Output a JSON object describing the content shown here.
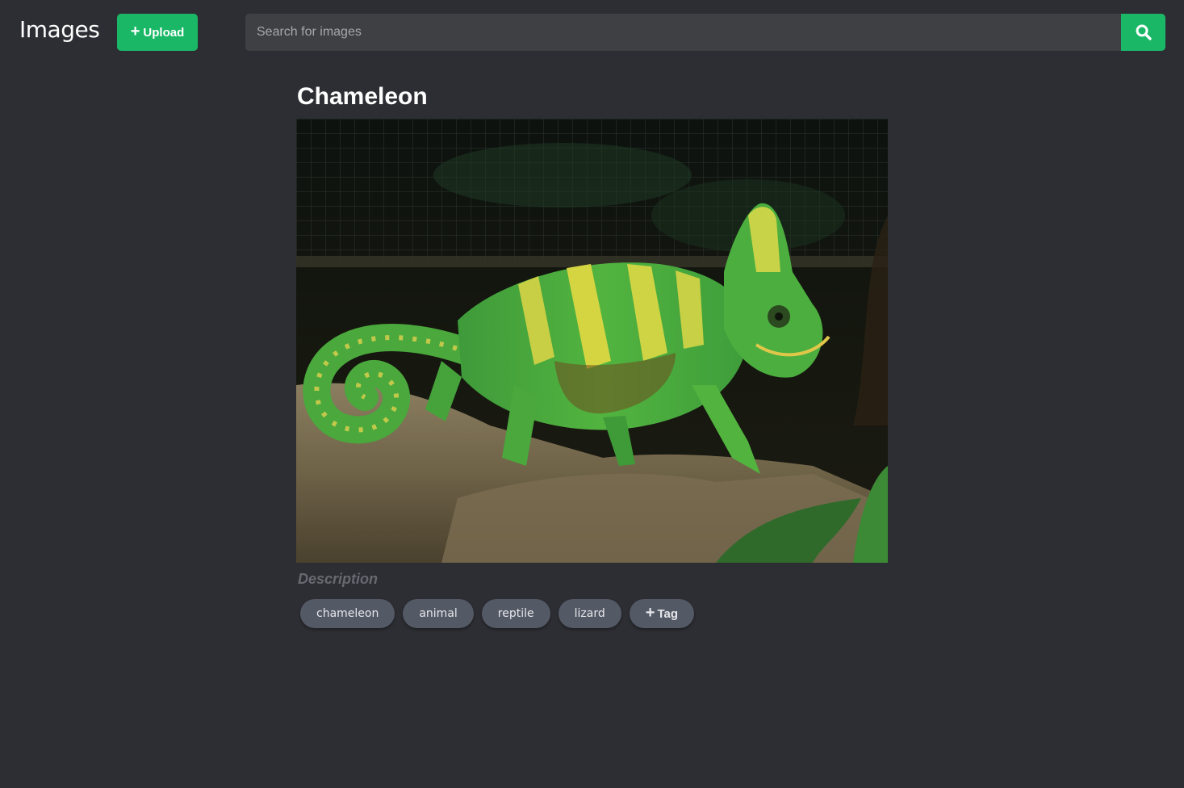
{
  "header": {
    "brand": "Images",
    "upload_label": "Upload",
    "search_placeholder": "Search for images",
    "search_value": "",
    "accent_color": "#1ab866"
  },
  "image": {
    "title": "Chameleon",
    "description_placeholder": "Description",
    "tags": [
      "chameleon",
      "animal",
      "reptile",
      "lizard"
    ],
    "add_tag_label": "Tag"
  }
}
